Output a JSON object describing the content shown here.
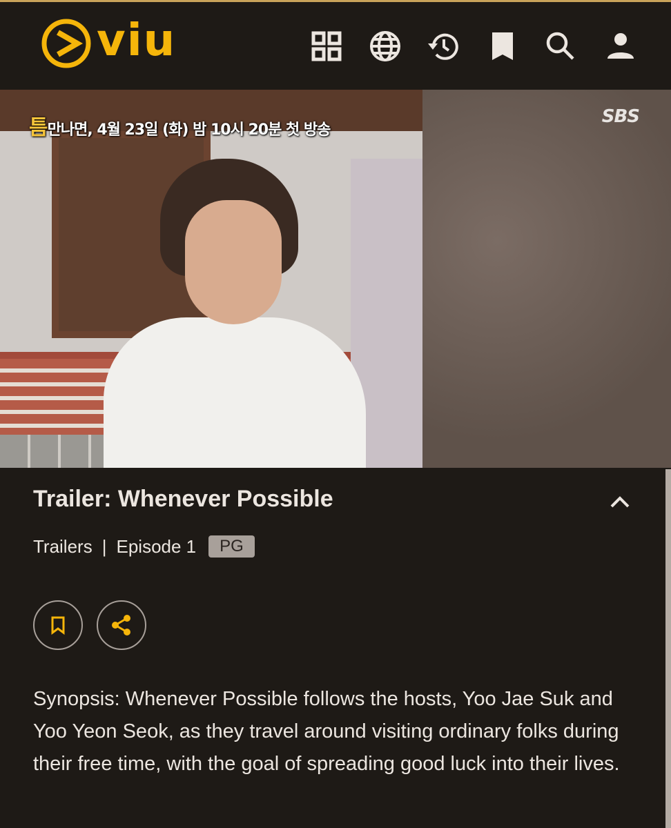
{
  "app": {
    "name": "viu",
    "brand_color": "#f5b50a"
  },
  "header": {
    "icons": [
      {
        "name": "categories-grid-icon",
        "label": "Categories"
      },
      {
        "name": "language-globe-icon",
        "label": "Language"
      },
      {
        "name": "history-icon",
        "label": "History"
      },
      {
        "name": "bookmark-icon",
        "label": "Watchlist"
      },
      {
        "name": "search-icon",
        "label": "Search"
      },
      {
        "name": "profile-icon",
        "label": "Account"
      }
    ]
  },
  "video": {
    "caption_highlight": "틈",
    "caption_text": "만나면, 4월 23일 (화) 밤 10시 20분 첫 방송",
    "broadcaster": "SBS"
  },
  "details": {
    "title": "Trailer: Whenever Possible",
    "category": "Trailers",
    "separator": "|",
    "episode": "Episode 1",
    "rating": "PG",
    "synopsis": "Synopsis: Whenever Possible follows the hosts, Yoo Jae Suk and Yoo Yeon Seok, as they travel around visiting ordinary folks during their free time, with the goal of spreading good luck into their lives."
  }
}
